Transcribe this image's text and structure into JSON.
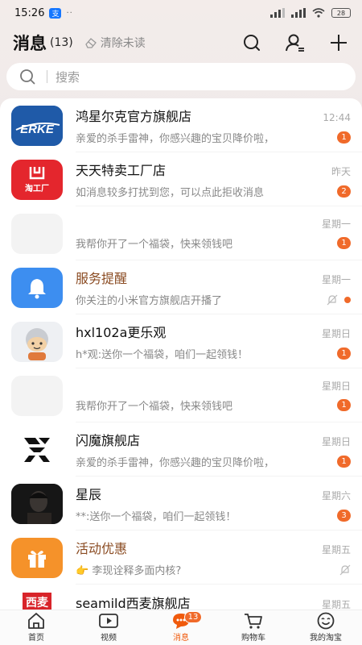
{
  "status_bar": {
    "time": "15:26",
    "app_badge": "支",
    "battery": "28"
  },
  "header": {
    "title": "消息",
    "count": "(13)",
    "clear_label": "清除未读"
  },
  "search": {
    "placeholder": "搜索"
  },
  "messages": [
    {
      "name": "鸿星尔克官方旗舰店",
      "time": "12:44",
      "preview": "亲爱的杀手雷神，你感兴趣的宝贝降价啦，",
      "badge": "1",
      "avatar_text": "ERKE"
    },
    {
      "name": "天天特卖工厂店",
      "time": "昨天",
      "preview": "如消息较多打扰到您，可以点此拒收消息",
      "badge": "2",
      "avatar_text": "淘工厂"
    },
    {
      "name": "",
      "time": "星期一",
      "preview": "我帮你开了一个福袋，快来领钱吧",
      "badge": "1"
    },
    {
      "name": "服务提醒",
      "time": "星期一",
      "preview": "你关注的小米官方旗舰店开播了"
    },
    {
      "name": "hxl102a更乐观",
      "time": "星期日",
      "preview": "h*观:送你一个福袋，咱们一起领钱！",
      "badge": "1"
    },
    {
      "name": "",
      "time": "星期日",
      "preview": "我帮你开了一个福袋，快来领钱吧",
      "badge": "1"
    },
    {
      "name": "闪魔旗舰店",
      "time": "星期日",
      "preview": "亲爱的杀手雷神，你感兴趣的宝贝降价啦，",
      "badge": "1"
    },
    {
      "name": "星辰",
      "time": "星期六",
      "preview": "**:送你一个福袋，咱们一起领钱！",
      "badge": "3"
    },
    {
      "name": "活动优惠",
      "time": "星期五",
      "preview": "李现诠释多面内核?"
    },
    {
      "name": "seamild西麦旗舰店",
      "time": "星期五",
      "avatar_text": "西麦"
    }
  ],
  "tabs": [
    {
      "label": "首页"
    },
    {
      "label": "视频"
    },
    {
      "label": "消息",
      "badge": "13"
    },
    {
      "label": "购物车"
    },
    {
      "label": "我的淘宝"
    }
  ],
  "colors": {
    "accent": "#f06a2a",
    "brown_name": "#8a4b22",
    "erke_blue": "#1f5aa8",
    "taogongchang_red": "#e4262d",
    "service_blue": "#3d8ef0",
    "promo_orange": "#f5922a"
  }
}
